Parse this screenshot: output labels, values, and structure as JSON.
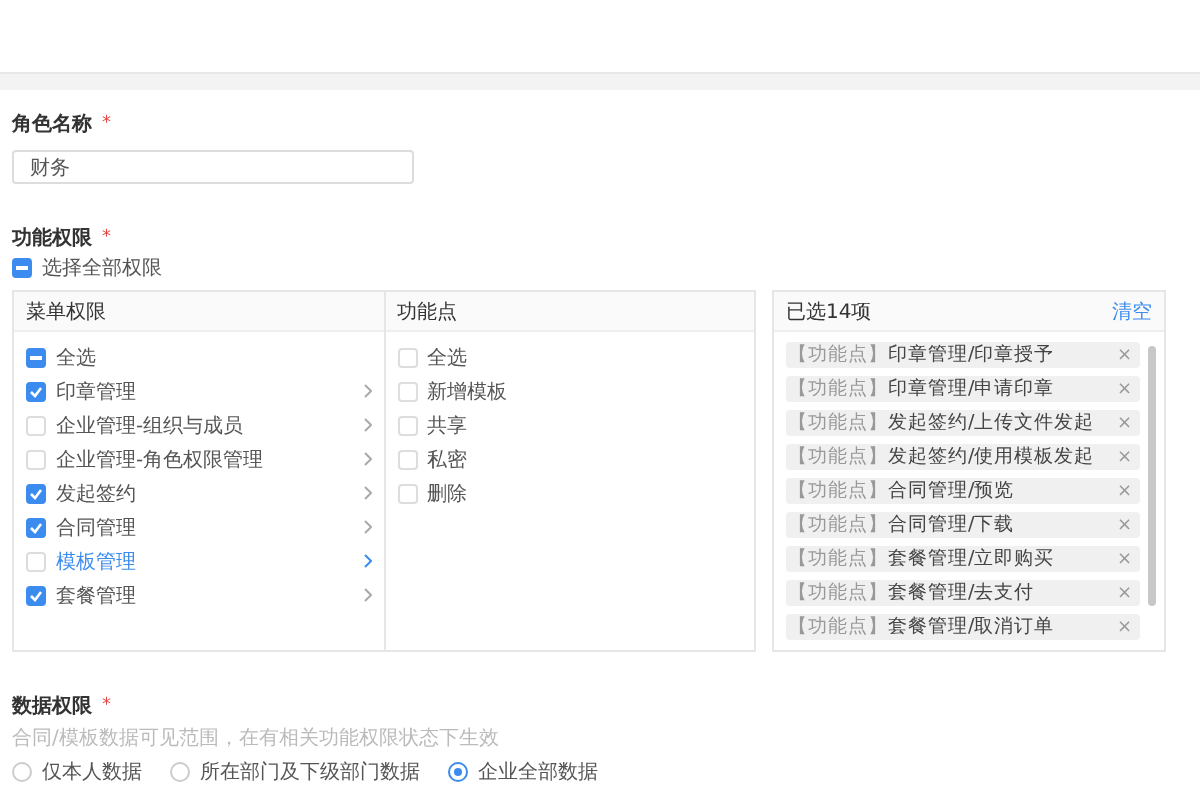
{
  "role_name": {
    "label": "角色名称",
    "required_mark": "*",
    "value": "财务"
  },
  "permissions": {
    "label": "功能权限",
    "required_mark": "*",
    "select_all": {
      "label": "选择全部权限",
      "checked": true,
      "partial": true
    },
    "menu": {
      "title": "菜单权限",
      "items": [
        {
          "label": "全选",
          "checked": true,
          "partial": true,
          "selected": false,
          "has_arrow": false
        },
        {
          "label": "印章管理",
          "checked": true,
          "partial": false,
          "selected": false,
          "has_arrow": true
        },
        {
          "label": "企业管理-组织与成员",
          "checked": false,
          "partial": false,
          "selected": false,
          "has_arrow": true
        },
        {
          "label": "企业管理-角色权限管理",
          "checked": false,
          "partial": false,
          "selected": false,
          "has_arrow": true
        },
        {
          "label": "发起签约",
          "checked": true,
          "partial": false,
          "selected": false,
          "has_arrow": true
        },
        {
          "label": "合同管理",
          "checked": true,
          "partial": false,
          "selected": false,
          "has_arrow": true
        },
        {
          "label": "模板管理",
          "checked": false,
          "partial": false,
          "selected": true,
          "has_arrow": true
        },
        {
          "label": "套餐管理",
          "checked": true,
          "partial": false,
          "selected": false,
          "has_arrow": true
        }
      ]
    },
    "points": {
      "title": "功能点",
      "items": [
        {
          "label": "全选",
          "checked": false
        },
        {
          "label": "新增模板",
          "checked": false
        },
        {
          "label": "共享",
          "checked": false
        },
        {
          "label": "私密",
          "checked": false
        },
        {
          "label": "删除",
          "checked": false
        }
      ]
    },
    "selected": {
      "title": "已选14项",
      "clear": "清空",
      "items": [
        {
          "tag": "【功能点】",
          "text": "印章管理/印章授予",
          "remove": "×"
        },
        {
          "tag": "【功能点】",
          "text": "印章管理/申请印章",
          "remove": "×"
        },
        {
          "tag": "【功能点】",
          "text": "发起签约/上传文件发起",
          "remove": "×"
        },
        {
          "tag": "【功能点】",
          "text": "发起签约/使用模板发起",
          "remove": "×"
        },
        {
          "tag": "【功能点】",
          "text": "合同管理/预览",
          "remove": "×"
        },
        {
          "tag": "【功能点】",
          "text": "合同管理/下载",
          "remove": "×"
        },
        {
          "tag": "【功能点】",
          "text": "套餐管理/立即购买",
          "remove": "×"
        },
        {
          "tag": "【功能点】",
          "text": "套餐管理/去支付",
          "remove": "×"
        },
        {
          "tag": "【功能点】",
          "text": "套餐管理/取消订单",
          "remove": "×"
        }
      ]
    }
  },
  "data_permissions": {
    "label": "数据权限",
    "required_mark": "*",
    "hint": "合同/模板数据可见范围，在有相关功能权限状态下生效",
    "options": [
      {
        "label": "仅本人数据",
        "selected": false
      },
      {
        "label": "所在部门及下级部门数据",
        "selected": false
      },
      {
        "label": "企业全部数据",
        "selected": true
      }
    ]
  }
}
